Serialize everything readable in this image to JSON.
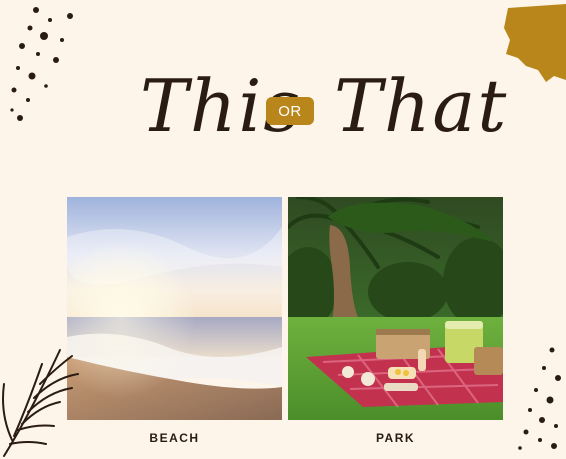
{
  "title": {
    "left_word": "This",
    "connector": "OR",
    "right_word": "That"
  },
  "options": [
    {
      "label": "BEACH",
      "image": "beach-sunset-photo"
    },
    {
      "label": "PARK",
      "image": "park-picnic-photo"
    }
  ],
  "colors": {
    "background": "#fdf5ea",
    "accent_gold": "#b8861a",
    "ink": "#2a1c12"
  }
}
